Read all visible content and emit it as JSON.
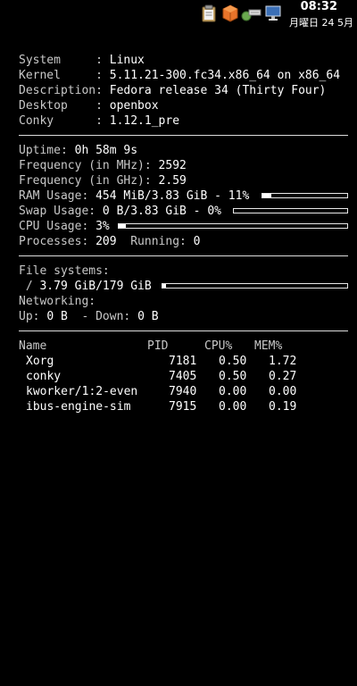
{
  "tray": {
    "icons": [
      "clipboard-icon",
      "package-cube-icon",
      "network-wired-icon",
      "monitor-icon"
    ],
    "time": "08:32",
    "date": "月曜日 24 5月"
  },
  "system": {
    "system_label": "System     : ",
    "system_value": "Linux",
    "kernel_label": "Kernel     : ",
    "kernel_value": "5.11.21-300.fc34.x86_64 on x86_64",
    "desc_label": "Description: ",
    "desc_value": "Fedora release 34 (Thirty Four)",
    "desktop_label": "Desktop    : ",
    "desktop_value": "openbox",
    "conky_label": "Conky      : ",
    "conky_value": "1.12.1_pre"
  },
  "stats": {
    "uptime_label": "Uptime: ",
    "uptime_value": "0h 58m 9s",
    "freq_mhz_label": "Frequency (in MHz): ",
    "freq_mhz_value": "2592",
    "freq_ghz_label": "Frequency (in GHz): ",
    "freq_ghz_value": "2.59",
    "ram_label": "RAM Usage: ",
    "ram_value": "454 MiB/3.83 GiB - 11%",
    "ram_fraction": 0.11,
    "swap_label": "Swap Usage: ",
    "swap_value": "0 B/3.83 GiB - 0%",
    "swap_fraction": 0.0,
    "cpu_label": "CPU Usage: ",
    "cpu_value": "3%",
    "cpu_fraction": 0.03,
    "processes_label": "Processes: ",
    "processes_value": "209",
    "running_label": "  Running: ",
    "running_value": "0"
  },
  "fs": {
    "title": "File systems:",
    "root_label": " / ",
    "root_value": "3.79 GiB/179 GiB",
    "root_fraction": 0.02,
    "net_title": "Networking:",
    "up_label": "Up: ",
    "up_value": "0 B",
    "down_label": "  - Down: ",
    "down_value": "0 B"
  },
  "procs": {
    "headers": [
      "Name",
      "PID",
      "CPU%",
      "MEM%"
    ],
    "rows": [
      {
        "name": "Xorg",
        "pid": "7181",
        "cpu": "0.50",
        "mem": "1.72"
      },
      {
        "name": "conky",
        "pid": "7405",
        "cpu": "0.50",
        "mem": "0.27"
      },
      {
        "name": "kworker/1:2-even",
        "pid": "7940",
        "cpu": "0.00",
        "mem": "0.00"
      },
      {
        "name": "ibus-engine-sim",
        "pid": "7915",
        "cpu": "0.00",
        "mem": "0.19"
      }
    ]
  }
}
